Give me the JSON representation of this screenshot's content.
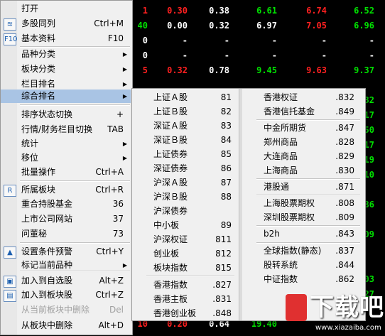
{
  "colors": {
    "red": "#ff2020",
    "green": "#00e000",
    "white": "#ffffff",
    "menu_bg": "#f0f0f0",
    "highlight": "#a9c4e4",
    "watermark": "#e03030"
  },
  "grid": {
    "rows": [
      {
        "cells": [
          {
            "t": "1",
            "c": "red"
          },
          {
            "t": "0.30",
            "c": "red"
          },
          {
            "t": "0.38",
            "c": "white"
          },
          {
            "t": "6.61",
            "c": "green"
          },
          {
            "t": "6.74",
            "c": "red"
          },
          {
            "t": "6.52",
            "c": "green"
          }
        ]
      },
      {
        "cells": [
          {
            "t": "40",
            "c": "green"
          },
          {
            "t": "0.00",
            "c": "white"
          },
          {
            "t": "0.32",
            "c": "white"
          },
          {
            "t": "6.97",
            "c": "white"
          },
          {
            "t": "7.05",
            "c": "red"
          },
          {
            "t": "6.96",
            "c": "green"
          }
        ]
      },
      {
        "cells": [
          {
            "t": "0",
            "c": "white"
          },
          {
            "t": "-",
            "c": "white"
          },
          {
            "t": "-",
            "c": "white"
          },
          {
            "t": "-",
            "c": "white"
          },
          {
            "t": "-",
            "c": "white"
          },
          {
            "t": "-",
            "c": "white"
          }
        ]
      },
      {
        "cells": [
          {
            "t": "0",
            "c": "white"
          },
          {
            "t": "-",
            "c": "white"
          },
          {
            "t": "-",
            "c": "white"
          },
          {
            "t": "-",
            "c": "white"
          },
          {
            "t": "-",
            "c": "white"
          },
          {
            "t": "-",
            "c": "white"
          }
        ]
      },
      {
        "cells": [
          {
            "t": "5",
            "c": "red"
          },
          {
            "t": "0.32",
            "c": "red"
          },
          {
            "t": "0.78",
            "c": "white"
          },
          {
            "t": "9.45",
            "c": "green"
          },
          {
            "t": "9.63",
            "c": "red"
          },
          {
            "t": "9.37",
            "c": "green"
          }
        ]
      },
      {
        "cells": [
          {
            "t": "",
            "c": "white"
          },
          {
            "t": "",
            "c": "white"
          },
          {
            "t": "",
            "c": "white"
          },
          {
            "t": "",
            "c": "white"
          },
          {
            "t": "",
            "c": "white"
          },
          {
            "t": "",
            "c": "white"
          }
        ]
      },
      {
        "cells": [
          {
            "t": "",
            "c": "white"
          },
          {
            "t": "",
            "c": "white"
          },
          {
            "t": "",
            "c": "white"
          },
          {
            "t": "",
            "c": "white"
          },
          {
            "t": "",
            "c": "white"
          },
          {
            "t": "32",
            "c": "green"
          }
        ]
      },
      {
        "cells": [
          {
            "t": "",
            "c": "white"
          },
          {
            "t": "",
            "c": "white"
          },
          {
            "t": "",
            "c": "white"
          },
          {
            "t": "",
            "c": "white"
          },
          {
            "t": "",
            "c": "white"
          },
          {
            "t": "17",
            "c": "green"
          }
        ]
      },
      {
        "cells": [
          {
            "t": "",
            "c": "white"
          },
          {
            "t": "",
            "c": "white"
          },
          {
            "t": "",
            "c": "white"
          },
          {
            "t": "",
            "c": "white"
          },
          {
            "t": "",
            "c": "white"
          },
          {
            "t": "50",
            "c": "green"
          }
        ]
      },
      {
        "cells": [
          {
            "t": "",
            "c": "white"
          },
          {
            "t": "",
            "c": "white"
          },
          {
            "t": "",
            "c": "white"
          },
          {
            "t": "",
            "c": "white"
          },
          {
            "t": "",
            "c": "white"
          },
          {
            "t": "17",
            "c": "green"
          }
        ]
      },
      {
        "cells": [
          {
            "t": "",
            "c": "white"
          },
          {
            "t": "",
            "c": "white"
          },
          {
            "t": "",
            "c": "white"
          },
          {
            "t": "",
            "c": "white"
          },
          {
            "t": "",
            "c": "white"
          },
          {
            "t": "19",
            "c": "green"
          }
        ]
      },
      {
        "cells": [
          {
            "t": "",
            "c": "white"
          },
          {
            "t": "",
            "c": "white"
          },
          {
            "t": "",
            "c": "white"
          },
          {
            "t": "",
            "c": "white"
          },
          {
            "t": "",
            "c": "white"
          },
          {
            "t": "10",
            "c": "green"
          }
        ]
      },
      {
        "cells": [
          {
            "t": "",
            "c": "white"
          },
          {
            "t": "",
            "c": "white"
          },
          {
            "t": "",
            "c": "white"
          },
          {
            "t": "",
            "c": "white"
          },
          {
            "t": "",
            "c": "white"
          },
          {
            "t": "",
            "c": "white"
          }
        ]
      },
      {
        "cells": [
          {
            "t": "",
            "c": "white"
          },
          {
            "t": "",
            "c": "white"
          },
          {
            "t": "",
            "c": "white"
          },
          {
            "t": "",
            "c": "white"
          },
          {
            "t": "",
            "c": "white"
          },
          {
            "t": "86",
            "c": "green"
          }
        ]
      },
      {
        "cells": [
          {
            "t": "",
            "c": "white"
          },
          {
            "t": "",
            "c": "white"
          },
          {
            "t": "",
            "c": "white"
          },
          {
            "t": "",
            "c": "white"
          },
          {
            "t": "",
            "c": "white"
          },
          {
            "t": "",
            "c": "white"
          }
        ]
      },
      {
        "cells": [
          {
            "t": "",
            "c": "white"
          },
          {
            "t": "",
            "c": "white"
          },
          {
            "t": "",
            "c": "white"
          },
          {
            "t": "",
            "c": "white"
          },
          {
            "t": "",
            "c": "white"
          },
          {
            "t": "09",
            "c": "green"
          }
        ]
      },
      {
        "cells": [
          {
            "t": "",
            "c": "white"
          },
          {
            "t": "",
            "c": "white"
          },
          {
            "t": "",
            "c": "white"
          },
          {
            "t": "",
            "c": "white"
          },
          {
            "t": "",
            "c": "white"
          },
          {
            "t": "",
            "c": "white"
          }
        ]
      },
      {
        "cells": [
          {
            "t": "",
            "c": "white"
          },
          {
            "t": "",
            "c": "white"
          },
          {
            "t": "",
            "c": "white"
          },
          {
            "t": "",
            "c": "white"
          },
          {
            "t": "",
            "c": "white"
          },
          {
            "t": "",
            "c": "white"
          }
        ]
      },
      {
        "cells": [
          {
            "t": "",
            "c": "white"
          },
          {
            "t": "",
            "c": "white"
          },
          {
            "t": "",
            "c": "white"
          },
          {
            "t": "",
            "c": "white"
          },
          {
            "t": "",
            "c": "white"
          },
          {
            "t": "03",
            "c": "green"
          }
        ]
      },
      {
        "cells": [
          {
            "t": "",
            "c": "white"
          },
          {
            "t": "",
            "c": "white"
          },
          {
            "t": "",
            "c": "white"
          },
          {
            "t": "",
            "c": "white"
          },
          {
            "t": "",
            "c": "white"
          },
          {
            "t": "27",
            "c": "green"
          }
        ]
      },
      {
        "cells": [
          {
            "t": "",
            "c": "white"
          },
          {
            "t": "",
            "c": "white"
          },
          {
            "t": "",
            "c": "white"
          },
          {
            "t": "",
            "c": "white"
          },
          {
            "t": "",
            "c": "white"
          },
          {
            "t": "",
            " c": "white"
          }
        ]
      },
      {
        "cells": [
          {
            "t": "10",
            "c": "red"
          },
          {
            "t": "0.20",
            "c": "red"
          },
          {
            "t": "0.64",
            "c": "white"
          },
          {
            "t": "19.40",
            "c": "green"
          },
          {
            "t": "",
            "c": "white"
          },
          {
            "t": "",
            "c": "white"
          }
        ]
      }
    ]
  },
  "main_menu": {
    "items": [
      {
        "label": "打开",
        "shortcut": "",
        "icon": "",
        "arrow": false
      },
      {
        "label": "多股同列",
        "shortcut": "Ctrl+M",
        "icon": "multi-chart-icon",
        "arrow": false
      },
      {
        "label": "基本资料",
        "shortcut": "F10",
        "icon": "f10-icon",
        "arrow": false
      },
      {
        "label": "品种分类",
        "shortcut": "",
        "icon": "",
        "arrow": true
      },
      {
        "label": "板块分类",
        "shortcut": "",
        "icon": "",
        "arrow": true
      },
      {
        "label": "栏目排名",
        "shortcut": "",
        "icon": "",
        "arrow": true
      },
      {
        "label": "综合排名",
        "shortcut": "",
        "icon": "",
        "arrow": true,
        "selected": true
      },
      {
        "label": "排序状态切换",
        "shortcut": "+",
        "icon": "",
        "arrow": false
      },
      {
        "label": "行情/财务栏目切换",
        "shortcut": "TAB",
        "icon": "",
        "arrow": false
      },
      {
        "label": "统计",
        "shortcut": "",
        "icon": "",
        "arrow": true
      },
      {
        "label": "移位",
        "shortcut": "",
        "icon": "",
        "arrow": true
      },
      {
        "label": "批量操作",
        "shortcut": "Ctrl+A",
        "icon": "",
        "arrow": false
      },
      {
        "label": "所属板块",
        "shortcut": "Ctrl+R",
        "icon": "r-icon",
        "arrow": false
      },
      {
        "label": "重合持股基金",
        "shortcut": "36",
        "icon": "",
        "arrow": false
      },
      {
        "label": "上市公司网站",
        "shortcut": "37",
        "icon": "",
        "arrow": false
      },
      {
        "label": "问董秘",
        "shortcut": "73",
        "icon": "",
        "arrow": false
      },
      {
        "label": "设置条件预警",
        "shortcut": "Ctrl+Y",
        "icon": "alert-up-icon",
        "arrow": false
      },
      {
        "label": "标记当前品种",
        "shortcut": "",
        "icon": "",
        "arrow": true
      },
      {
        "label": "加入到自选股",
        "shortcut": "Alt+Z",
        "icon": "add-watch-icon",
        "arrow": false
      },
      {
        "label": "加入到板块股",
        "shortcut": "Ctrl+Z",
        "icon": "add-block-icon",
        "arrow": false
      },
      {
        "label": "从当前板块中删除",
        "shortcut": "Del",
        "icon": "",
        "arrow": false,
        "disabled": true
      },
      {
        "label": "从板块中删除",
        "shortcut": "Alt+D",
        "icon": "",
        "arrow": false
      }
    ]
  },
  "submenu1": {
    "items": [
      {
        "name": "上证Ａ股",
        "code": "81"
      },
      {
        "name": "上证Ｂ股",
        "code": "82"
      },
      {
        "name": "深证Ａ股",
        "code": "83"
      },
      {
        "name": "深证Ｂ股",
        "code": "84"
      },
      {
        "name": "上证债券",
        "code": "85"
      },
      {
        "name": "深证债券",
        "code": "86"
      },
      {
        "name": "沪深Ａ股",
        "code": "87"
      },
      {
        "name": "沪深Ｂ股",
        "code": "88"
      },
      {
        "name": "沪深债券",
        "code": ""
      },
      {
        "name": "中小板",
        "code": "89"
      },
      {
        "name": "沪深权证",
        "code": "811"
      },
      {
        "name": "创业板",
        "code": "812"
      },
      {
        "name": "板块指数",
        "code": "815"
      },
      {
        "name": "香港指数",
        "code": ".827"
      },
      {
        "name": "香港主板",
        "code": ".831"
      },
      {
        "name": "香港创业板",
        "code": ".848"
      }
    ]
  },
  "submenu2": {
    "items": [
      {
        "name": "香港权证",
        "code": ".832"
      },
      {
        "name": "香港信托基金",
        "code": ".849"
      },
      {
        "name": "中金所期货",
        "code": ".847"
      },
      {
        "name": "郑州商品",
        "code": ".828"
      },
      {
        "name": "大连商品",
        "code": ".829"
      },
      {
        "name": "上海商品",
        "code": ".830"
      },
      {
        "name": "港股通",
        "code": ".871"
      },
      {
        "name": "上海股票期权",
        "code": ".808"
      },
      {
        "name": "深圳股票期权",
        "code": ".809"
      },
      {
        "name": "b2h",
        "code": ".843"
      },
      {
        "name": "全球指数(静态)",
        "code": ".837"
      },
      {
        "name": "股转系统",
        "code": ".844"
      },
      {
        "name": "中证指数",
        "code": ".862"
      }
    ]
  },
  "watermark": {
    "text": "下载吧",
    "url": "www.xiazaiba.com"
  }
}
